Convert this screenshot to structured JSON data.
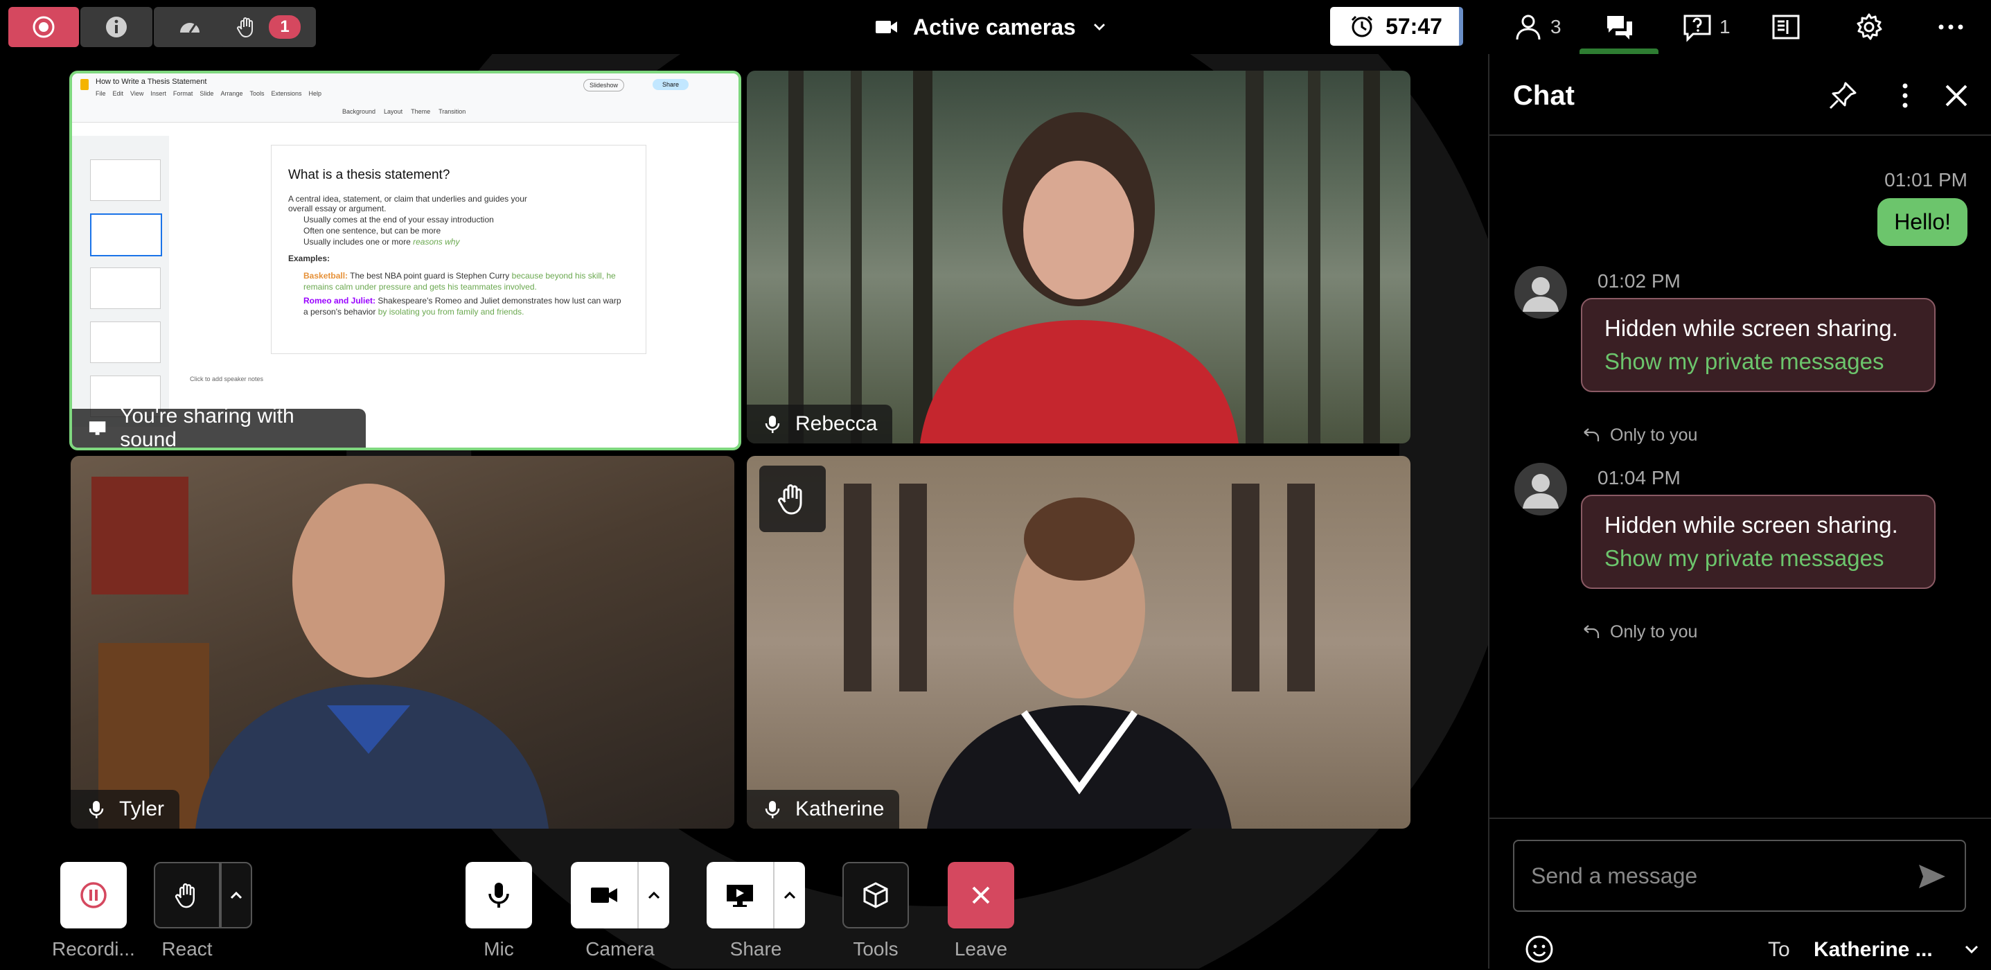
{
  "topbar": {
    "hand_count": "1",
    "view_label": "Active cameras",
    "timer": "57:47",
    "participants_count": "3",
    "questions_count": "1"
  },
  "stage": {
    "share": {
      "label": "You're sharing with sound",
      "doc_title": "How to Write a Thesis Statement",
      "menu": [
        "File",
        "Edit",
        "View",
        "Insert",
        "Format",
        "Slide",
        "Arrange",
        "Tools",
        "Extensions",
        "Help"
      ],
      "toolbar": [
        "Background",
        "Layout",
        "Theme",
        "Transition"
      ],
      "slideshow": "Slideshow",
      "share_btn": "Share",
      "slide_title": "What is a thesis statement?",
      "slide_lines": [
        "A central idea, statement, or claim that underlies and guides your",
        "overall essay or argument.",
        "Usually comes at the end of your essay introduction",
        "Often one sentence, but can be more",
        "Usually includes one or more"
      ],
      "slide_reasons": "reasons why",
      "examples_label": "Examples:",
      "ex1_label": "Basketball:",
      "ex1_text": "The best NBA point guard is Stephen Curry",
      "ex1_green": "because beyond his skill, he remains calm under pressure and gets his teammates involved.",
      "ex2_label": "Romeo and Juliet:",
      "ex2_text": "Shakespeare's Romeo and Juliet demonstrates how lust can warp a person's behavior",
      "ex2_green": "by isolating you from family and friends.",
      "speaker_notes": "Click to add speaker notes"
    },
    "participants": [
      {
        "name": "Rebecca"
      },
      {
        "name": "Tyler"
      },
      {
        "name": "Katherine"
      }
    ]
  },
  "controls": {
    "recording": "Recordi...",
    "react": "React",
    "mic": "Mic",
    "camera": "Camera",
    "share": "Share",
    "tools": "Tools",
    "leave": "Leave"
  },
  "chat": {
    "title": "Chat",
    "messages": [
      {
        "time": "01:01 PM",
        "text": "Hello!"
      },
      {
        "time": "01:02 PM",
        "text": "Hidden while screen sharing.",
        "link": "Show my private messages",
        "note": "Only to you"
      },
      {
        "time": "01:04 PM",
        "text": "Hidden while screen sharing.",
        "link": "Show my private messages",
        "note": "Only to you"
      }
    ],
    "input_placeholder": "Send a message",
    "to_label": "To",
    "to_value": "Katherine ..."
  },
  "colors": {
    "accent_green": "#6cc56c",
    "record_red": "#d5485f",
    "private_bubble": "#3a1f24"
  }
}
